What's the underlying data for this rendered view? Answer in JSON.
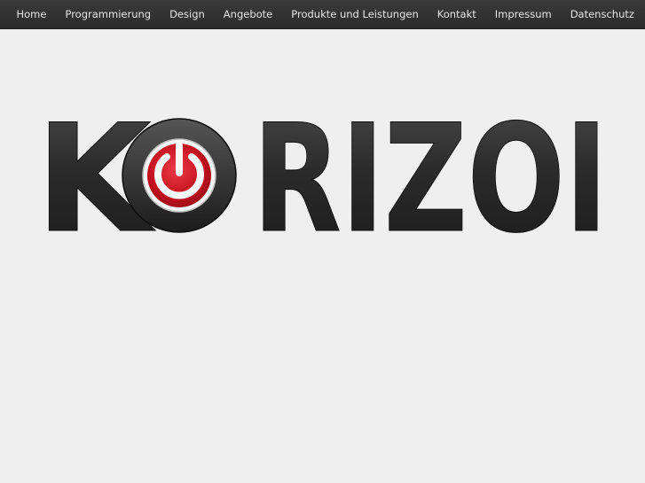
{
  "nav": {
    "items": [
      "Home",
      "Programmierung",
      "Design",
      "Angebote",
      "Produkte und Leistungen",
      "Kontakt",
      "Impressum",
      "Datenschutz"
    ]
  },
  "logo": {
    "text": "KORIZOI",
    "letters_before_icon": "K",
    "letters_after_icon": "RIZOI",
    "icon": "power-button-icon",
    "accent_color": "#d21d2b",
    "letter_color": "#2a2a2a"
  }
}
